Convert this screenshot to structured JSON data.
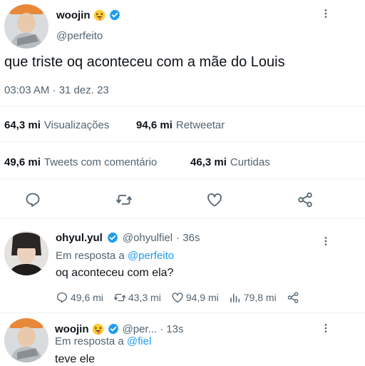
{
  "main_tweet": {
    "display_name": "woojin",
    "emoji": "squinting-face-with-tongue",
    "handle": "@perfeito",
    "text": "que triste oq aconteceu com a mãe do Louis",
    "timestamp": "03:03 AM · 31 dez. 23",
    "stats": {
      "views_count": "64,3 mi",
      "views_label": "Visualizações",
      "retweets_count": "94,6 mi",
      "retweets_label": "Retweetar",
      "quotes_count": "49,6 mi",
      "quotes_label": "Tweets com comentário",
      "likes_count": "46,3 mi",
      "likes_label": "Curtidas"
    },
    "actions": [
      "reply-icon",
      "retweet-icon",
      "like-icon",
      "share-icon"
    ]
  },
  "replies": [
    {
      "display_name": "ohyul.yul",
      "handle": "@ohyulfiel",
      "time": "· 36s",
      "reply_prefix": "Em resposta a",
      "reply_to": "@perfeito",
      "text": "oq aconteceu com ela?",
      "reply_count": "49,6 mi",
      "retweet_count": "43,3 mi",
      "like_count": "94,9 mi",
      "views_count": "79,8 mi"
    },
    {
      "display_name": "woojin",
      "emoji": "squinting-face-with-tongue",
      "handle": "@per...",
      "time": "· 13s",
      "reply_prefix": "Em resposta a",
      "reply_to": "@fiel",
      "text": "teve ele"
    }
  ],
  "colors": {
    "accent": "#1d9bf0",
    "muted": "#536471",
    "text": "#0f1419"
  }
}
